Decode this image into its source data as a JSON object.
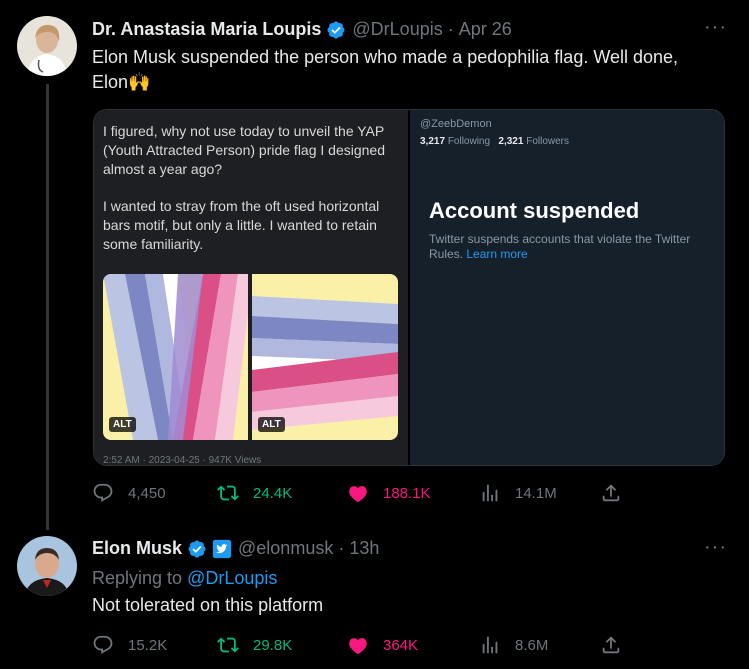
{
  "tweet1": {
    "name": "Dr. Anastasia Maria Loupis",
    "handle": "@DrLoupis",
    "time": "Apr 26",
    "text_line1": "Elon Musk suspended the person who made a pedophilia flag. Well done,",
    "text_line2": "Elon🙌",
    "media": {
      "left_text_p1": "I figured, why not use today to unveil the YAP (Youth Attracted Person) pride flag I designed almost a year ago?",
      "left_text_p2": "I wanted to stray from the oft used horizontal bars motif, but only a little. I wanted to retain some familiarity.",
      "alt_label": "ALT",
      "faded_meta": "2:52 AM · 2023-04-25 · 947K Views",
      "right_handle": "@ZeebDemon",
      "right_following_count": "3,217",
      "right_following_label": "Following",
      "right_followers_count": "2,321",
      "right_followers_label": "Followers",
      "suspended_title": "Account suspended",
      "suspended_desc": "Twitter suspends accounts that violate the Twitter Rules.",
      "learn_more": "Learn more"
    },
    "replies": "4,450",
    "retweets": "24.4K",
    "likes": "188.1K",
    "views": "14.1M"
  },
  "tweet2": {
    "name": "Elon Musk",
    "handle": "@elonmusk",
    "time": "13h",
    "replying_prefix": "Replying to",
    "replying_to": "@DrLoupis",
    "text": "Not tolerated on this platform",
    "replies": "15.2K",
    "retweets": "29.8K",
    "likes": "364K",
    "views": "8.6M"
  },
  "colors": {
    "retweet": "#00ba7c",
    "like": "#f91880",
    "link": "#1d9bf0",
    "muted": "#71767b"
  }
}
